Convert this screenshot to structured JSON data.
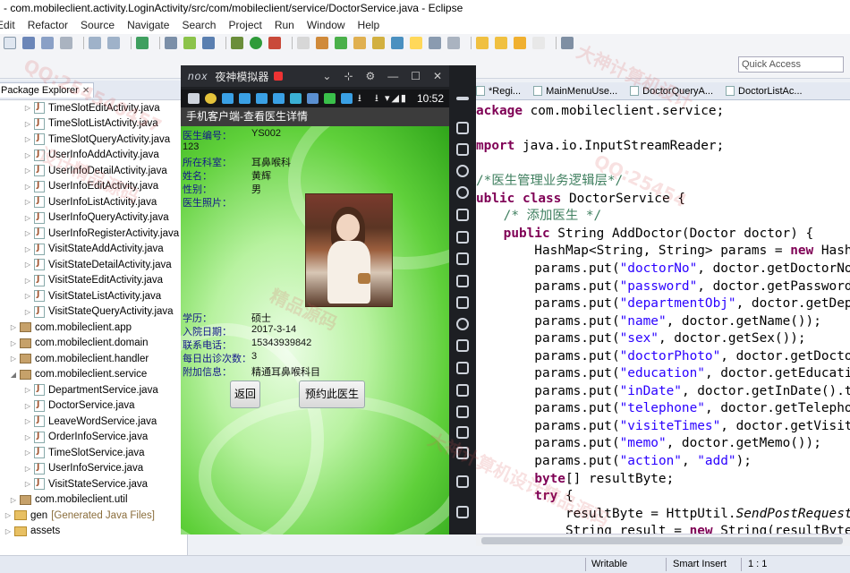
{
  "window": {
    "title": "- com.mobileclient.activity.LoginActivity/src/com/mobileclient/service/DoctorService.java - Eclipse"
  },
  "menu": [
    "Edit",
    "Refactor",
    "Source",
    "Navigate",
    "Search",
    "Project",
    "Run",
    "Window",
    "Help"
  ],
  "quick_access": {
    "placeholder": "Quick Access"
  },
  "package_explorer": {
    "tab_label": "Package Explorer",
    "items": [
      {
        "label": "TimeSlotEditActivity.java",
        "kind": "java",
        "indent": 3
      },
      {
        "label": "TimeSlotListActivity.java",
        "kind": "java",
        "indent": 3
      },
      {
        "label": "TimeSlotQueryActivity.java",
        "kind": "java",
        "indent": 3
      },
      {
        "label": "UserInfoAddActivity.java",
        "kind": "java",
        "indent": 3
      },
      {
        "label": "UserInfoDetailActivity.java",
        "kind": "java",
        "indent": 3
      },
      {
        "label": "UserInfoEditActivity.java",
        "kind": "java",
        "indent": 3
      },
      {
        "label": "UserInfoListActivity.java",
        "kind": "java",
        "indent": 3
      },
      {
        "label": "UserInfoQueryActivity.java",
        "kind": "java",
        "indent": 3
      },
      {
        "label": "UserInfoRegisterActivity.java",
        "kind": "java",
        "indent": 3
      },
      {
        "label": "VisitStateAddActivity.java",
        "kind": "java",
        "indent": 3
      },
      {
        "label": "VisitStateDetailActivity.java",
        "kind": "java",
        "indent": 3
      },
      {
        "label": "VisitStateEditActivity.java",
        "kind": "java",
        "indent": 3
      },
      {
        "label": "VisitStateListActivity.java",
        "kind": "java",
        "indent": 3
      },
      {
        "label": "VisitStateQueryActivity.java",
        "kind": "java",
        "indent": 3
      },
      {
        "label": "com.mobileclient.app",
        "kind": "package",
        "indent": 2
      },
      {
        "label": "com.mobileclient.domain",
        "kind": "package",
        "indent": 2
      },
      {
        "label": "com.mobileclient.handler",
        "kind": "package",
        "indent": 2
      },
      {
        "label": "com.mobileclient.service",
        "kind": "package-open",
        "indent": 2
      },
      {
        "label": "DepartmentService.java",
        "kind": "java",
        "indent": 3
      },
      {
        "label": "DoctorService.java",
        "kind": "java",
        "indent": 3
      },
      {
        "label": "LeaveWordService.java",
        "kind": "java",
        "indent": 3
      },
      {
        "label": "OrderInfoService.java",
        "kind": "java",
        "indent": 3
      },
      {
        "label": "TimeSlotService.java",
        "kind": "java",
        "indent": 3
      },
      {
        "label": "UserInfoService.java",
        "kind": "java",
        "indent": 3
      },
      {
        "label": "VisitStateService.java",
        "kind": "java",
        "indent": 3
      },
      {
        "label": "com.mobileclient.util",
        "kind": "package",
        "indent": 2
      },
      {
        "label": "gen",
        "note": "[Generated Java Files]",
        "kind": "folder",
        "indent": 0
      },
      {
        "label": "assets",
        "kind": "folder",
        "indent": 0
      }
    ]
  },
  "emulator": {
    "logo": "nox",
    "title": "夜神模拟器",
    "time": "10:52",
    "app_title": "手机客户端-查看医生详情",
    "fields": {
      "doctor_no_label": "医生编号：",
      "doctor_no_value": "YS002",
      "password_value": "123",
      "department_label": "所在科室：",
      "department_value": "耳鼻喉科",
      "name_label": "姓名：",
      "name_value": "黄辉",
      "sex_label": "性别：",
      "sex_value": "男",
      "photo_label": "医生照片：",
      "education_label": "学历：",
      "education_value": "硕士",
      "in_date_label": "入院日期：",
      "in_date_value": "2017-3-14",
      "telephone_label": "联系电话：",
      "telephone_value": "15343939842",
      "visit_times_label": "每日出诊次数：",
      "visit_times_value": "3",
      "memo_label": "附加信息：",
      "memo_value": "精通耳鼻喉科目"
    },
    "buttons": {
      "back": "返回",
      "book": "预约此医生"
    }
  },
  "editor": {
    "tabs": [
      "*Regi...",
      "MainMenuUse...",
      "DoctorQueryA...",
      "DoctorListAc..."
    ],
    "code": [
      "ackage com.mobileclient.service;",
      "",
      "mport java.io.InputStreamReader;",
      "",
      "/*医生管理业务逻辑层*/",
      "ublic class DoctorService {",
      "    /* 添加医生 */",
      "    public String AddDoctor(Doctor doctor) {",
      "        HashMap<String, String> params = new HashM",
      "        params.put(\"doctorNo\", doctor.getDoctorNo",
      "        params.put(\"password\", doctor.getPassword",
      "        params.put(\"departmentObj\", doctor.getDep",
      "        params.put(\"name\", doctor.getName());",
      "        params.put(\"sex\", doctor.getSex());",
      "        params.put(\"doctorPhoto\", doctor.getDocto",
      "        params.put(\"education\", doctor.getEducati",
      "        params.put(\"inDate\", doctor.getInDate().t",
      "        params.put(\"telephone\", doctor.getTelepho",
      "        params.put(\"visiteTimes\", doctor.getVisit",
      "        params.put(\"memo\", doctor.getMemo());",
      "        params.put(\"action\", \"add\");",
      "        byte[] resultByte;",
      "        try {",
      "            resultByte = HttpUtil.SendPostRequest",
      "            String result = new String(resultByte"
    ]
  },
  "status": {
    "writable": "Writable",
    "insert_mode": "Smart Insert",
    "position": "1 : 1"
  },
  "watermarks": [
    "QQ:254540457",
    "大神计算机设计",
    "精品源码",
    "设计精品源码",
    "QQ:25454",
    "大神计算机设计精品源码"
  ],
  "colors": {
    "keyword": "#7f0055",
    "string": "#2a00ff",
    "comment": "#3f7f5f",
    "label": "#13188a"
  }
}
